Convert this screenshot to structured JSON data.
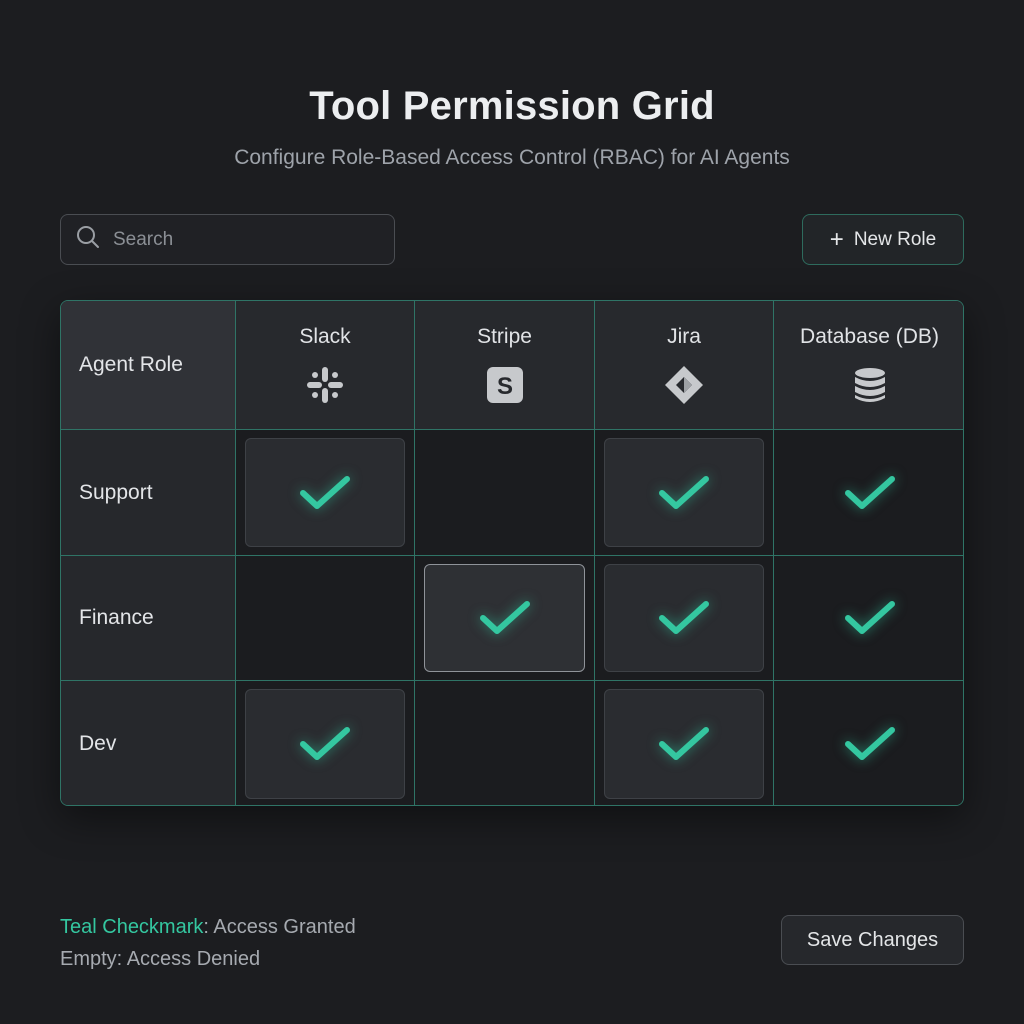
{
  "header": {
    "title": "Tool Permission Grid",
    "subtitle": "Configure Role-Based Access Control (RBAC) for AI Agents"
  },
  "toolbar": {
    "search_placeholder": "Search",
    "search_icon": "search-icon",
    "new_role_icon": "plus-icon",
    "new_role_label": "New Role"
  },
  "grid": {
    "corner_label": "Agent Role",
    "tools": [
      {
        "name": "Slack",
        "icon": "slack-icon"
      },
      {
        "name": "Stripe",
        "icon": "stripe-icon"
      },
      {
        "name": "Jira",
        "icon": "jira-icon"
      },
      {
        "name": "Database (DB)",
        "icon": "database-icon"
      }
    ],
    "roles": [
      {
        "name": "Support",
        "permissions": [
          true,
          false,
          true,
          true
        ]
      },
      {
        "name": "Finance",
        "permissions": [
          false,
          true,
          true,
          true
        ]
      },
      {
        "name": "Dev",
        "permissions": [
          true,
          false,
          true,
          true
        ]
      }
    ],
    "selected_cell": {
      "role": "Finance",
      "tool": "Stripe"
    }
  },
  "legend": {
    "granted_key": "Teal Checkmark",
    "granted_value": ": Access Granted",
    "denied_text": "Empty: Access Denied"
  },
  "footer": {
    "save_label": "Save Changes"
  },
  "colors": {
    "background": "#1c1d20",
    "accent_teal": "#34c7a0",
    "grid_border": "#2f7466"
  }
}
